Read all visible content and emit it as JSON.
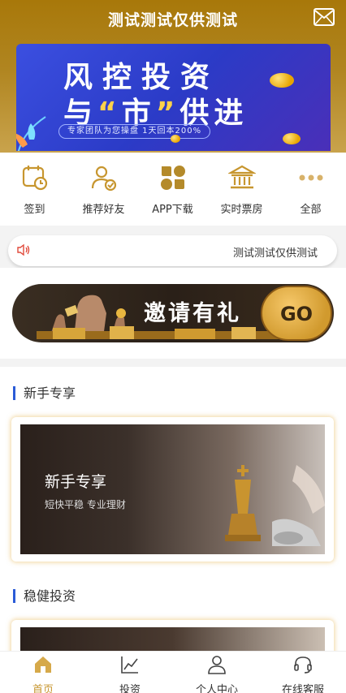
{
  "header": {
    "title": "测试测试仅供测试"
  },
  "banner": {
    "line1": "风控投资",
    "line2_before": "与",
    "line2_quote_open": "“",
    "line2_mid": "市",
    "line2_quote_close": "”",
    "line2_after": "供进",
    "subtitle": "专家团队为您操盘 1天回本200%"
  },
  "quick_menu": {
    "items": [
      {
        "label": "签到",
        "icon": "calendar-clock-icon"
      },
      {
        "label": "推荐好友",
        "icon": "user-check-icon"
      },
      {
        "label": "APP下载",
        "icon": "app-grid-icon"
      },
      {
        "label": "实时票房",
        "icon": "bank-icon"
      },
      {
        "label": "全部",
        "icon": "more-dots-icon"
      }
    ]
  },
  "notice": {
    "text": "测试测试仅供测试",
    "icon": "speaker-icon"
  },
  "invite_banner": {
    "title": "邀请有礼",
    "go_label": "GO"
  },
  "sections": [
    {
      "title": "新手专享",
      "card": {
        "title": "新手专享",
        "subtitle": "短快平稳 专业理财"
      }
    },
    {
      "title": "稳健投资"
    }
  ],
  "tabbar": {
    "items": [
      {
        "label": "首页",
        "icon": "home-icon",
        "active": true
      },
      {
        "label": "投资",
        "icon": "chart-line-icon",
        "active": false
      },
      {
        "label": "个人中心",
        "icon": "user-icon",
        "active": false
      },
      {
        "label": "在线客服",
        "icon": "headset-icon",
        "active": false
      }
    ]
  },
  "colors": {
    "gold": "#c7962f",
    "header_gold": "#a8780a",
    "accent_blue": "#2a5bd7",
    "notice_red": "#e0493a"
  }
}
